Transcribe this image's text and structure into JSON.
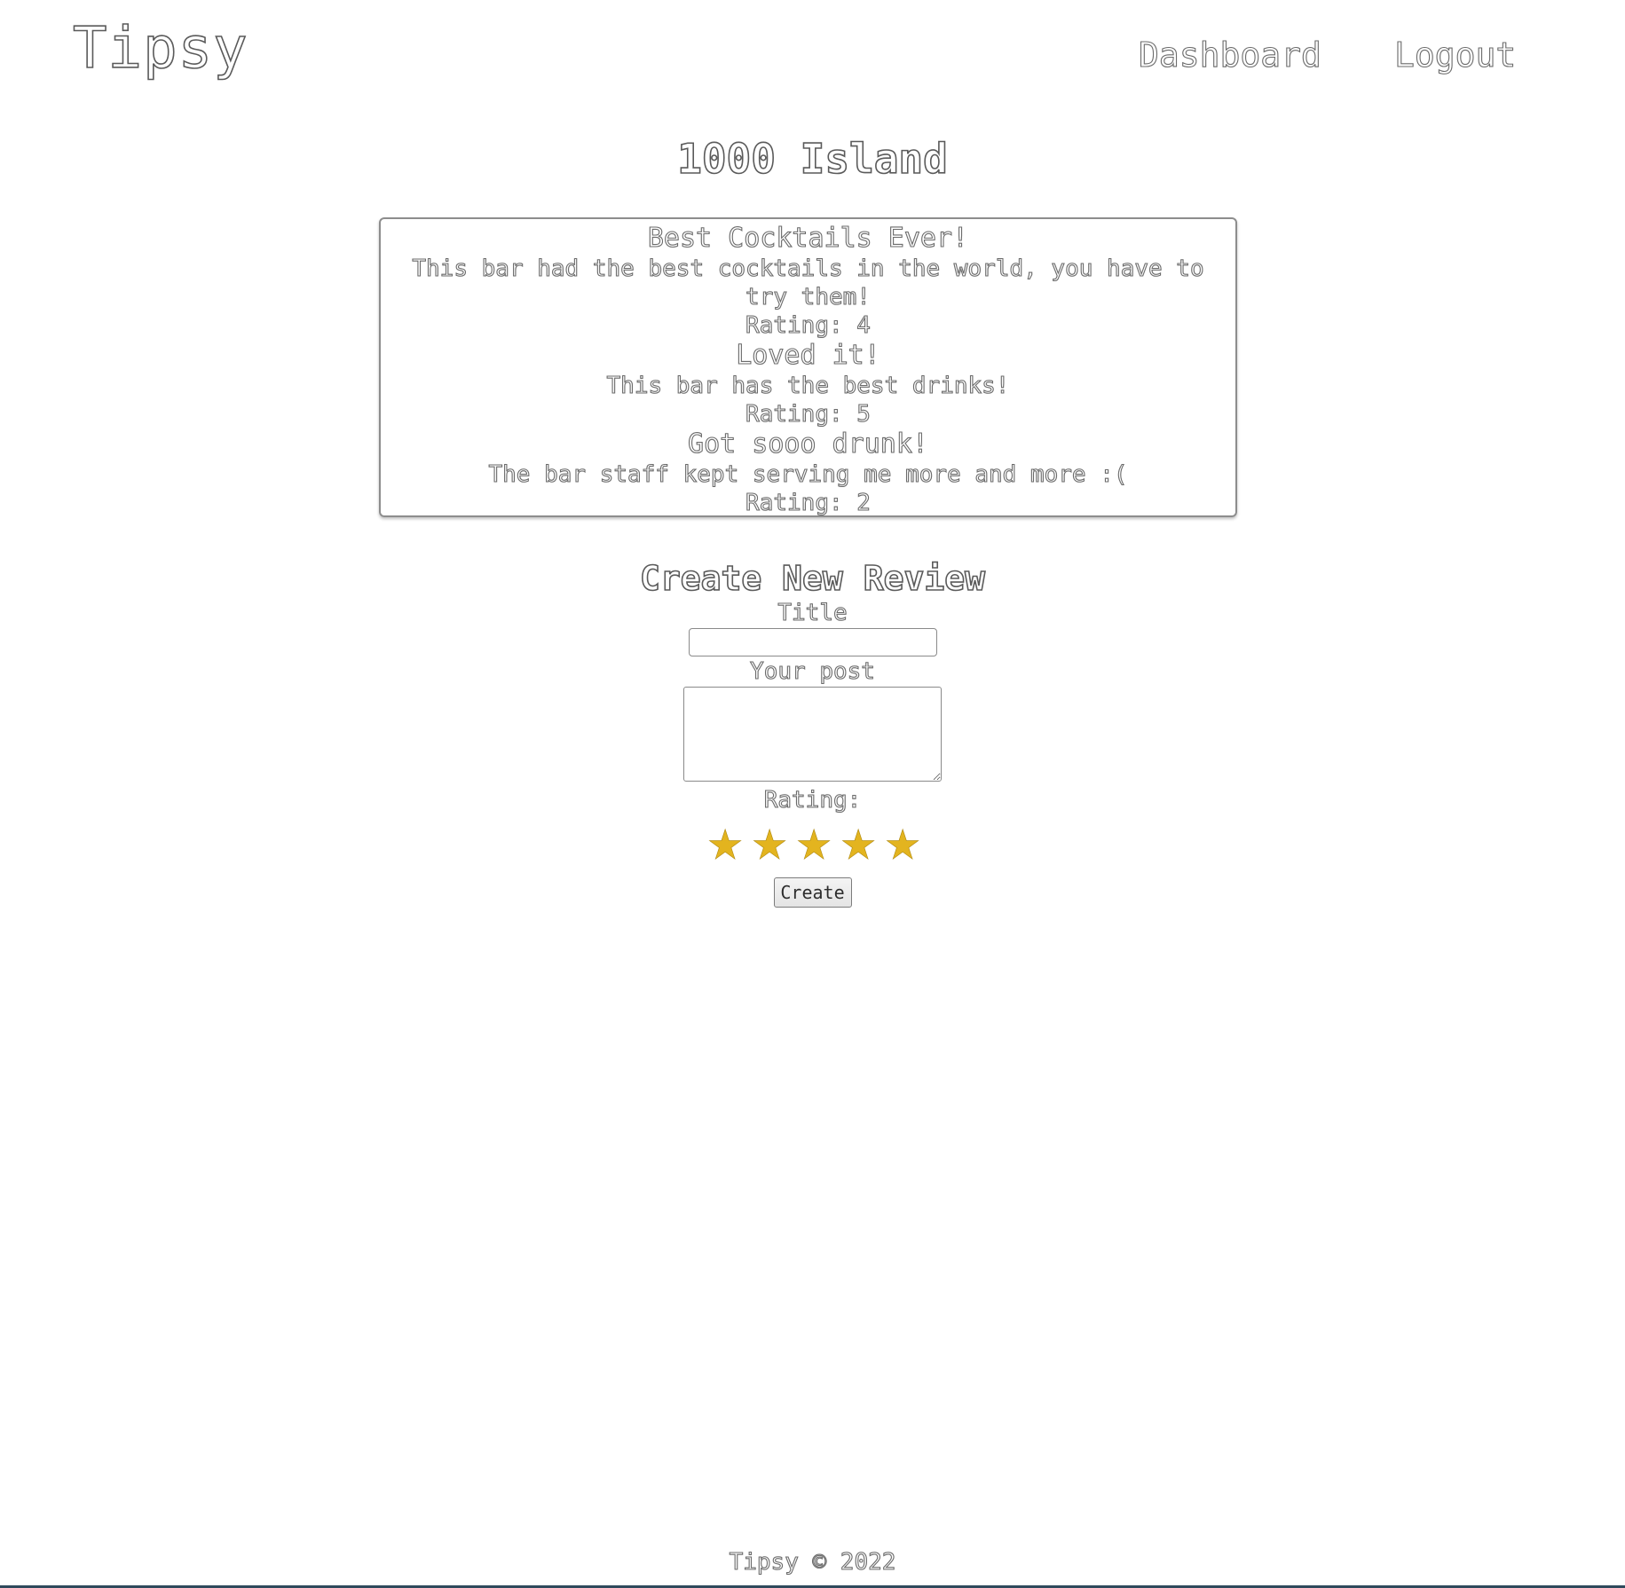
{
  "header": {
    "brand": "Tipsy",
    "nav": {
      "dashboard": "Dashboard",
      "logout": "Logout"
    }
  },
  "venue": {
    "name": "1000 Island"
  },
  "reviews": [
    {
      "title": "Best Cocktails Ever!",
      "body": "This bar had the best cocktails in the world, you have to try them!",
      "rating": "Rating: 4"
    },
    {
      "title": "Loved it!",
      "body": "This bar has the best drinks!",
      "rating": "Rating: 5"
    },
    {
      "title": "Got sooo drunk!",
      "body": "The bar staff kept serving me more and more :(",
      "rating": "Rating: 2"
    }
  ],
  "create_form": {
    "heading": "Create New Review",
    "title_label": "Title",
    "title_value": "",
    "post_label": "Your post",
    "post_value": "",
    "rating_label": "Rating:",
    "stars": [
      "star",
      "star",
      "star",
      "star",
      "star"
    ],
    "star_glyph": "★",
    "star_color": "#e3b41f",
    "submit_label": "Create"
  },
  "footer": {
    "text": "Tipsy © 2022"
  },
  "colors": {
    "background": "#ffffff",
    "text_outline": "#6b6b6b",
    "bottom_rule": "#2f4a5c"
  }
}
